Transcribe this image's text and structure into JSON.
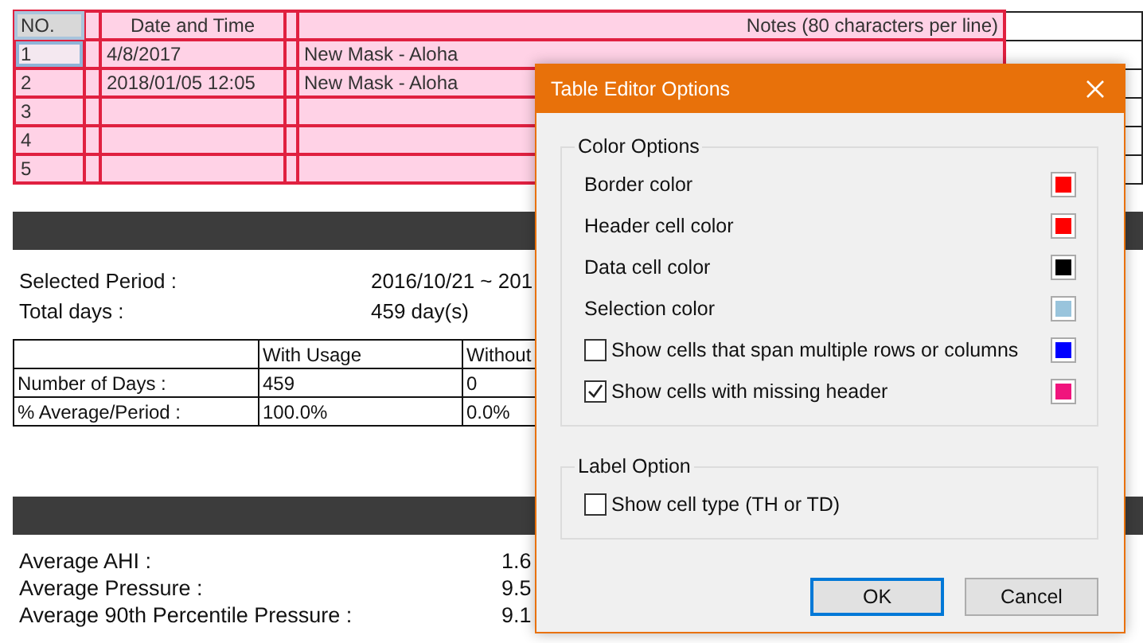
{
  "notes_table": {
    "columns": [
      "NO.",
      "",
      "Date and Time",
      "",
      "Notes (80 characters per line)"
    ],
    "rows": [
      {
        "no": "1",
        "date": "4/8/2017",
        "note": "New Mask - Aloha",
        "selected": true
      },
      {
        "no": "2",
        "date": "2018/01/05 12:05",
        "note": "New Mask - Aloha",
        "selected": false
      },
      {
        "no": "3",
        "date": "",
        "note": "",
        "selected": false
      },
      {
        "no": "4",
        "date": "",
        "note": "",
        "selected": false
      },
      {
        "no": "5",
        "date": "",
        "note": "",
        "selected": false
      }
    ]
  },
  "period": [
    {
      "label": "Selected Period :",
      "value": "2016/10/21 ~ 201"
    },
    {
      "label": "Total days :",
      "value": "459 day(s)"
    }
  ],
  "usage_table": {
    "columns": [
      "",
      "With Usage",
      "Without"
    ],
    "rows": [
      [
        "Number of Days :",
        "459",
        "0"
      ],
      [
        "% Average/Period :",
        "100.0%",
        "0.0%"
      ]
    ]
  },
  "averages": [
    {
      "label": "Average AHI :",
      "value": "1.6"
    },
    {
      "label": "Average Pressure :",
      "value": "9.5"
    },
    {
      "label": "Average 90th Percentile Pressure :",
      "value": "9.1"
    }
  ],
  "dialog": {
    "title": "Table Editor Options",
    "color_group": {
      "title": "Color Options",
      "items": [
        {
          "kind": "color",
          "label": "Border color",
          "color": "#ff0000"
        },
        {
          "kind": "color",
          "label": "Header cell color",
          "color": "#ff0000"
        },
        {
          "kind": "color",
          "label": "Data cell color",
          "color": "#000000"
        },
        {
          "kind": "color",
          "label": "Selection color",
          "color": "#99c4dc"
        },
        {
          "kind": "check",
          "label": "Show cells that span multiple rows or columns",
          "checked": false,
          "color": "#0000ff"
        },
        {
          "kind": "check",
          "label": "Show cells with missing header",
          "checked": true,
          "color": "#f0147d"
        }
      ]
    },
    "label_group": {
      "title": "Label Option",
      "items": [
        {
          "label": "Show cell type (TH or TD)",
          "checked": false
        }
      ]
    },
    "buttons": [
      {
        "label": "OK",
        "default": true
      },
      {
        "label": "Cancel",
        "default": false
      }
    ]
  }
}
